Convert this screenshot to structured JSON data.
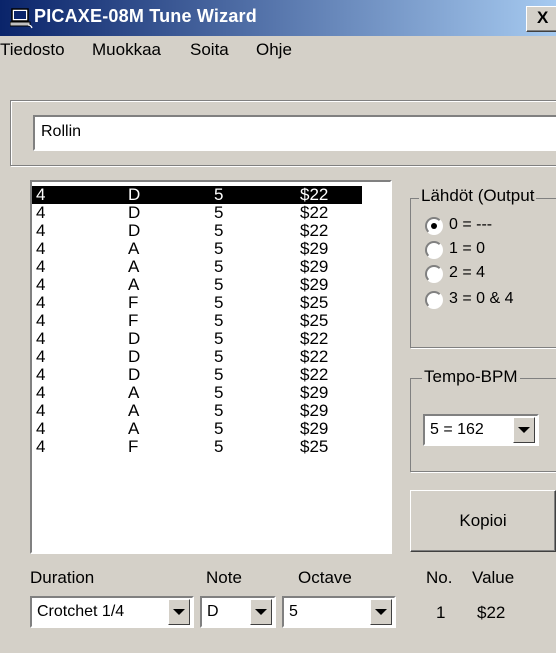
{
  "window": {
    "title": "PICAXE-08M Tune Wizard",
    "close_glyph": "X"
  },
  "menu": [
    "Tiedosto",
    "Muokkaa",
    "Soita",
    "Ohje"
  ],
  "tune_name": "Rollin",
  "notes": [
    [
      "4",
      "D",
      "5",
      "$22"
    ],
    [
      "4",
      "D",
      "5",
      "$22"
    ],
    [
      "4",
      "D",
      "5",
      "$22"
    ],
    [
      "4",
      "A",
      "5",
      "$29"
    ],
    [
      "4",
      "A",
      "5",
      "$29"
    ],
    [
      "4",
      "A",
      "5",
      "$29"
    ],
    [
      "4",
      "F",
      "5",
      "$25"
    ],
    [
      "4",
      "F",
      "5",
      "$25"
    ],
    [
      "4",
      "D",
      "5",
      "$22"
    ],
    [
      "4",
      "D",
      "5",
      "$22"
    ],
    [
      "4",
      "D",
      "5",
      "$22"
    ],
    [
      "4",
      "A",
      "5",
      "$29"
    ],
    [
      "4",
      "A",
      "5",
      "$29"
    ],
    [
      "4",
      "A",
      "5",
      "$29"
    ],
    [
      "4",
      "F",
      "5",
      "$25"
    ]
  ],
  "outputs": {
    "label": "Lähdöt (Output",
    "options": [
      "0 = ---",
      "1 = 0",
      "2 = 4",
      "3 = 0 & 4"
    ],
    "selected": 0
  },
  "tempo": {
    "label": "Tempo-BPM",
    "value": "5  = 162"
  },
  "copy_button": "Kopioi",
  "fields": {
    "duration_label": "Duration",
    "duration_value": "Crotchet 1/4",
    "note_label": "Note",
    "note_value": "D",
    "octave_label": "Octave",
    "octave_value": "5",
    "number_label": "No.",
    "number_value": "1",
    "value_label": "Value",
    "value_value": "$22"
  },
  "colors": {
    "face": "#d4d0c8",
    "title_start": "#0a246a",
    "title_end": "#a6caf0",
    "selection": "#000000"
  }
}
